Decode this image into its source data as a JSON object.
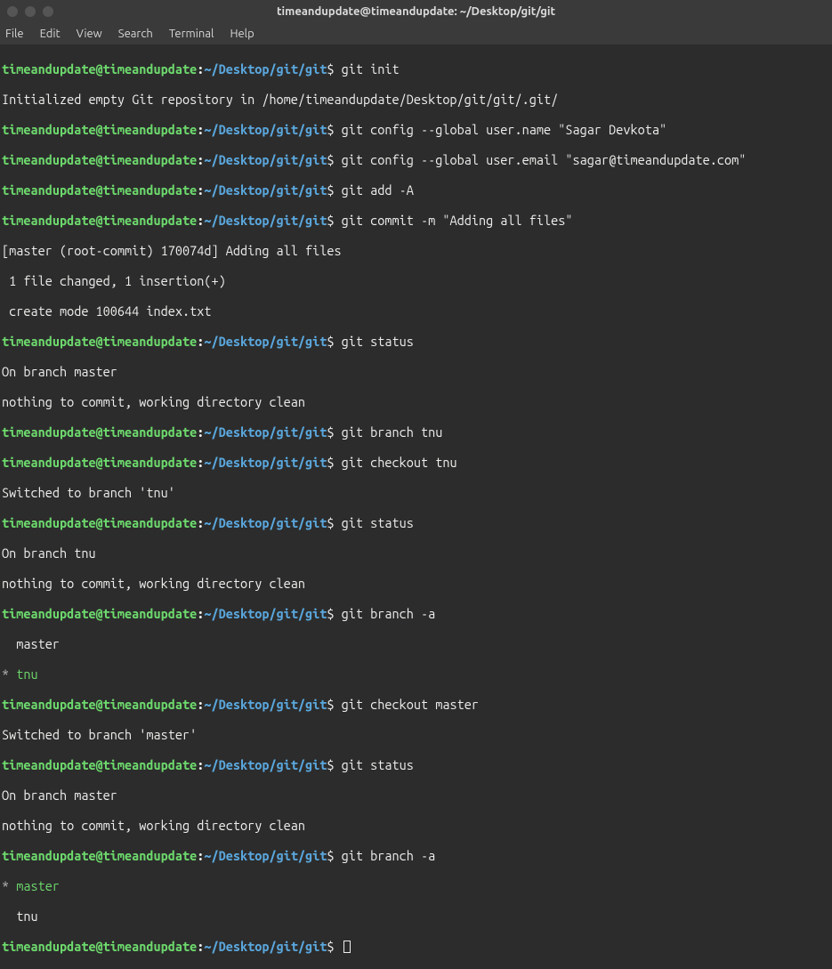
{
  "window": {
    "title": "timeandupdate@timeandupdate: ~/Desktop/git/git"
  },
  "menu": {
    "file": "File",
    "edit": "Edit",
    "view": "View",
    "search": "Search",
    "terminal": "Terminal",
    "help": "Help"
  },
  "prompt": {
    "user": "timeandupdate@timeandupdate",
    "path": "~/Desktop/git/git"
  },
  "lines": {
    "l1_cmd": "git init",
    "l2": "Initialized empty Git repository in /home/timeandupdate/Desktop/git/git/.git/",
    "l3_cmd": "git config --global user.name \"Sagar Devkota\"",
    "l4_cmd": "git config --global user.email \"sagar@timeandupdate.com\"",
    "l5_cmd": "git add -A",
    "l6_cmd": "git commit -m \"Adding all files\"",
    "l7": "[master (root-commit) 170074d] Adding all files",
    "l8": " 1 file changed, 1 insertion(+)",
    "l9": " create mode 100644 index.txt",
    "l10_cmd": "git status",
    "l11": "On branch master",
    "l12": "nothing to commit, working directory clean",
    "l13_cmd": "git branch tnu",
    "l14_cmd": "git checkout tnu",
    "l15": "Switched to branch 'tnu'",
    "l16_cmd": "git status",
    "l17": "On branch tnu",
    "l18": "nothing to commit, working directory clean",
    "l19_cmd": "git branch -a",
    "l20": "  master",
    "l21_star": "*",
    "l21_branch": " tnu",
    "l22_cmd": "git checkout master",
    "l23": "Switched to branch 'master'",
    "l24_cmd": "git status",
    "l25": "On branch master",
    "l26": "nothing to commit, working directory clean",
    "l27_cmd": "git branch -a",
    "l28_star": "*",
    "l28_branch": " master",
    "l29": "  tnu"
  }
}
